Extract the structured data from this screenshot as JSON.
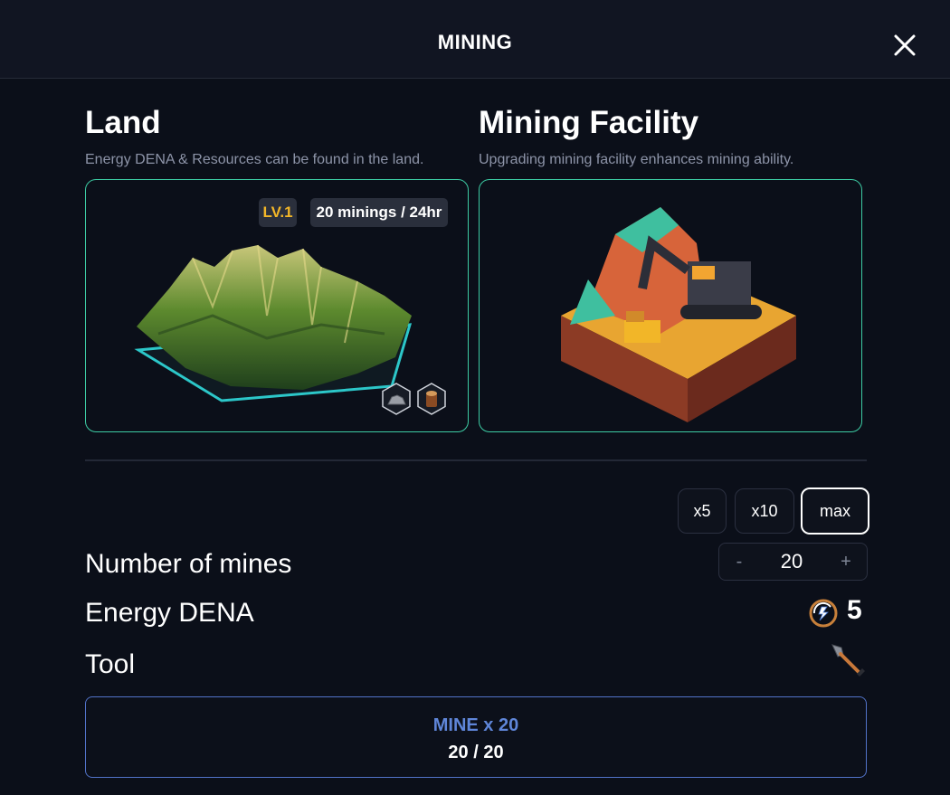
{
  "header": {
    "title": "MINING"
  },
  "land": {
    "title": "Land",
    "description": "Energy DENA & Resources can be found in the land.",
    "level": "LV.1",
    "minings": "20 minings / 24hr",
    "resources": [
      "stone-icon",
      "wood-icon"
    ]
  },
  "facility": {
    "title": "Mining Facility",
    "description": "Upgrading mining facility enhances mining ability."
  },
  "quick_select": {
    "x5": "x5",
    "x10": "x10",
    "max": "max",
    "selected": "max"
  },
  "mines": {
    "label": "Number of mines",
    "minus": "-",
    "value": "20",
    "plus": "+"
  },
  "energy": {
    "label": "Energy DENA",
    "value": "5"
  },
  "tool": {
    "label": "Tool",
    "icon": "shovel-icon"
  },
  "mine_button": {
    "label": "MINE x 20",
    "progress": "20 / 20"
  },
  "colors": {
    "accent": "#3dcca4",
    "level": "#f2b628",
    "mine_label": "#5f86d9"
  }
}
